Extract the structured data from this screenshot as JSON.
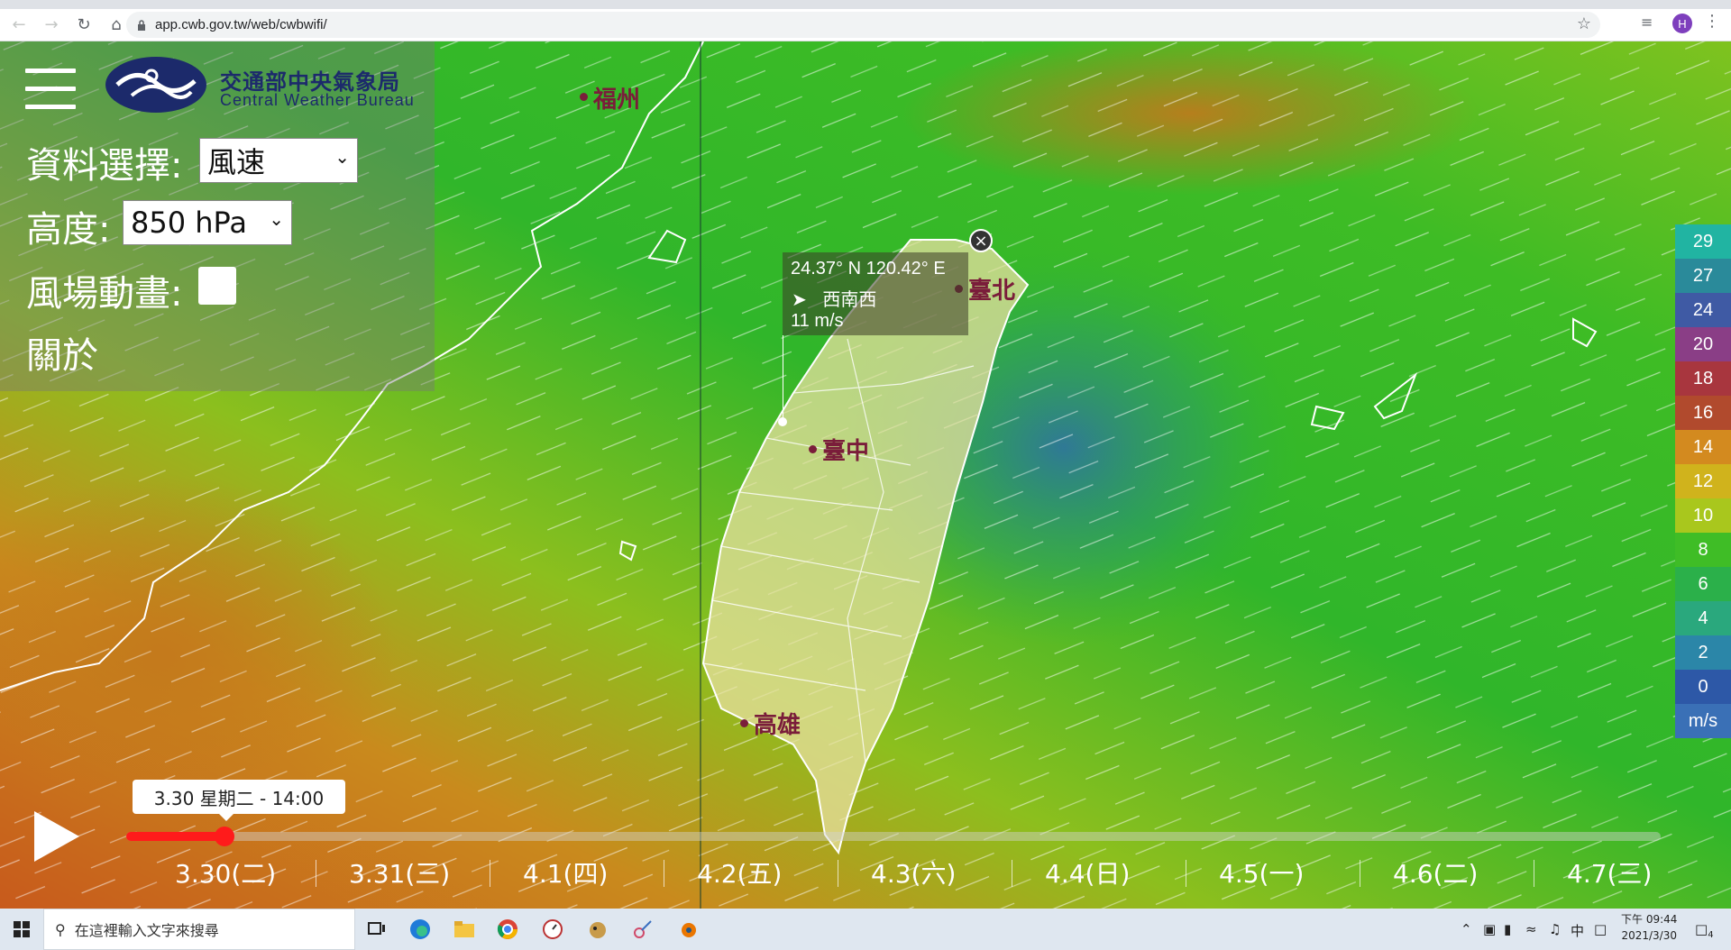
{
  "browser": {
    "url": "app.cwb.gov.tw/web/cwbwifi/",
    "profile_initial": "H"
  },
  "panel": {
    "org_name_zh": "交通部中央氣象局",
    "org_name_en": "Central Weather Bureau",
    "data_select_label": "資料選擇:",
    "data_select_value": "風速",
    "height_label": "高度:",
    "height_value": "850 hPa",
    "animation_label": "風場動畫:",
    "animation_checked": false,
    "about_label": "關於"
  },
  "tooltip": {
    "coords": "24.37° N  120.42° E",
    "direction": "西南西",
    "speed": "11 m/s"
  },
  "cities": {
    "fuzhou": "福州",
    "taipei": "臺北",
    "taichung": "臺中",
    "kaohsiung": "高雄"
  },
  "legend": {
    "items": [
      {
        "value": "29",
        "color": "#21b4a2"
      },
      {
        "value": "27",
        "color": "#2a8a9a"
      },
      {
        "value": "24",
        "color": "#3f5aa4"
      },
      {
        "value": "20",
        "color": "#8a3e86"
      },
      {
        "value": "18",
        "color": "#a8363e"
      },
      {
        "value": "16",
        "color": "#b14a2d"
      },
      {
        "value": "14",
        "color": "#d38a1f"
      },
      {
        "value": "12",
        "color": "#d0b31c"
      },
      {
        "value": "10",
        "color": "#a9c71d"
      },
      {
        "value": "8",
        "color": "#3fbd26"
      },
      {
        "value": "6",
        "color": "#2bb04a"
      },
      {
        "value": "4",
        "color": "#2aa87d"
      },
      {
        "value": "2",
        "color": "#2b86a8"
      },
      {
        "value": "0",
        "color": "#2d58a7"
      },
      {
        "value": "m/s",
        "color": "#3a70b6"
      }
    ]
  },
  "timeline": {
    "current_label": "3.30 星期二 - 14:00",
    "progress_fraction": 0.064,
    "ticks": [
      "3.30(二)",
      "3.31(三)",
      "4.1(四)",
      "4.2(五)",
      "4.3(六)",
      "4.4(日)",
      "4.5(一)",
      "4.6(二)",
      "4.7(三)"
    ]
  },
  "taskbar": {
    "search_placeholder": "在這裡輸入文字來搜尋",
    "ime": "中",
    "time": "下午 09:44",
    "date": "2021/3/30",
    "notification_count": "4"
  }
}
